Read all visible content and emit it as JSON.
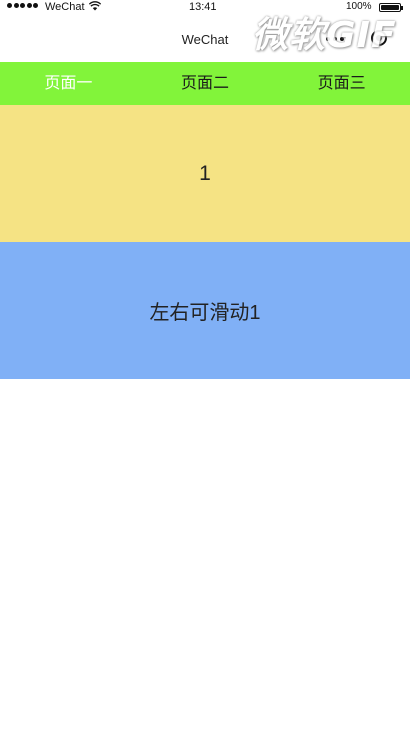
{
  "status_bar": {
    "carrier": "WeChat",
    "time": "13:41",
    "battery": "100%"
  },
  "nav": {
    "title": "WeChat",
    "watermark": "微软GIF"
  },
  "tabs": [
    {
      "label": "页面一",
      "active": true
    },
    {
      "label": "页面二",
      "active": false
    },
    {
      "label": "页面三",
      "active": false
    }
  ],
  "swiper": {
    "slide_number": "1"
  },
  "scroll_area": {
    "text": "左右可滑动1"
  },
  "colors": {
    "tab_bar": "#82f43a",
    "swiper_bg": "#f5e384",
    "scroll_bg": "#80b0f6"
  }
}
